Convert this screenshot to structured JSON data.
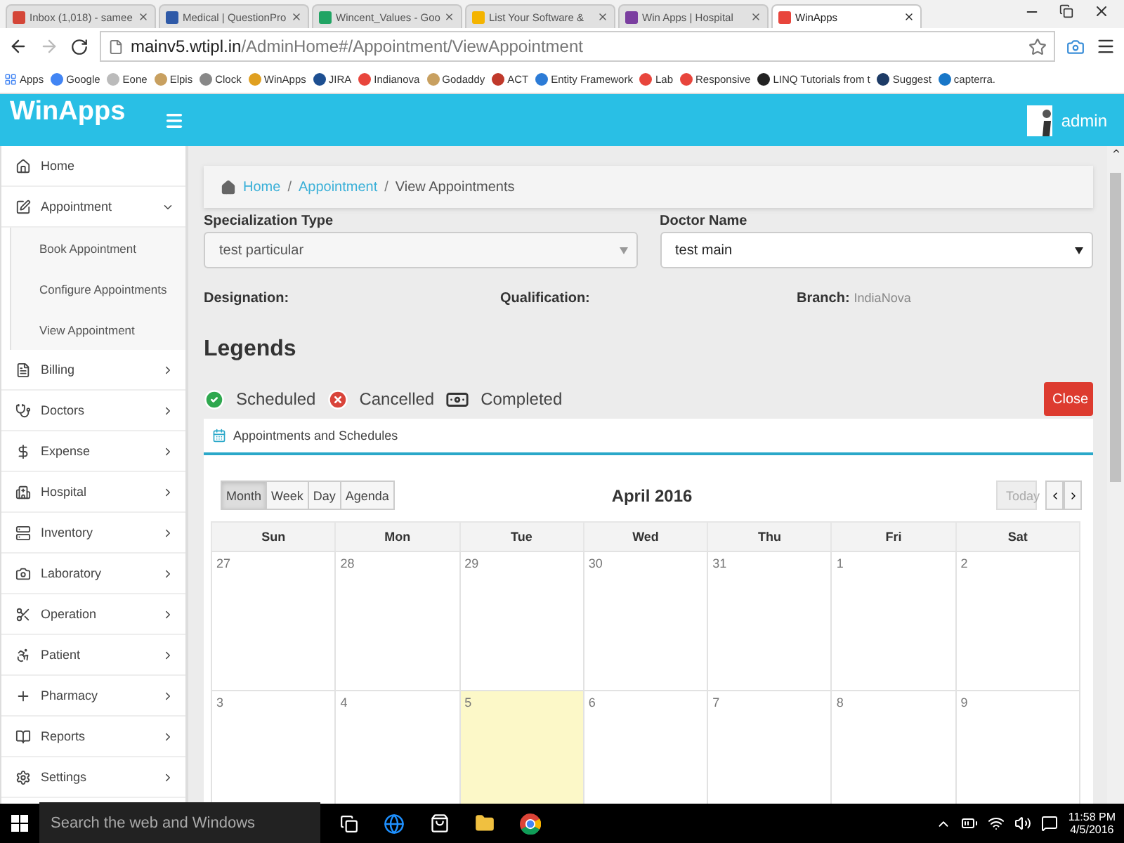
{
  "browser": {
    "tabs": [
      {
        "title": "Inbox (1,018) - samee",
        "selected": false
      },
      {
        "title": "Medical | QuestionPro",
        "selected": false
      },
      {
        "title": "Wincent_Values - Goo",
        "selected": false
      },
      {
        "title": "List Your Software &",
        "selected": false
      },
      {
        "title": "Win Apps | Hospital",
        "selected": false
      },
      {
        "title": "WinApps",
        "selected": true
      }
    ],
    "address": {
      "host": "mainv5.wtipl.in",
      "path": "/AdminHome#/Appointment/ViewAppointment"
    },
    "bookmarks": [
      "Apps",
      "Google",
      "Eone",
      "Elpis",
      "Clock",
      "WinApps",
      "JIRA",
      "Indianova",
      "Godaddy",
      "ACT",
      "Entity Framework",
      "Lab",
      "Responsive",
      "LINQ Tutorials from t",
      "Suggest",
      "capterra."
    ]
  },
  "header": {
    "logo": "WinApps",
    "user": "admin"
  },
  "sidebar": {
    "items": [
      {
        "label": "Home",
        "kind": "link"
      },
      {
        "label": "Appointment",
        "kind": "menu",
        "expanded": true,
        "children": [
          {
            "label": "Book Appointment"
          },
          {
            "label": "Configure Appointments"
          },
          {
            "label": "View Appointment"
          }
        ]
      },
      {
        "label": "Billing",
        "kind": "menu",
        "expanded": false
      },
      {
        "label": "Doctors",
        "kind": "menu",
        "expanded": false
      },
      {
        "label": "Expense",
        "kind": "menu",
        "expanded": false
      },
      {
        "label": "Hospital",
        "kind": "menu",
        "expanded": false
      },
      {
        "label": "Inventory",
        "kind": "menu",
        "expanded": false
      },
      {
        "label": "Laboratory",
        "kind": "menu",
        "expanded": false
      },
      {
        "label": "Operation",
        "kind": "menu",
        "expanded": false
      },
      {
        "label": "Patient",
        "kind": "menu",
        "expanded": false
      },
      {
        "label": "Pharmacy",
        "kind": "menu",
        "expanded": false
      },
      {
        "label": "Reports",
        "kind": "menu",
        "expanded": false
      },
      {
        "label": "Settings",
        "kind": "menu",
        "expanded": false
      }
    ]
  },
  "breadcrumb": {
    "items": [
      {
        "label": "Home",
        "link": true
      },
      {
        "label": "Appointment",
        "link": true
      },
      {
        "label": "View Appointments",
        "link": false
      }
    ],
    "separators": [
      "/",
      "/"
    ]
  },
  "form": {
    "selects": [
      {
        "label": "Specialization Type",
        "value": "test particular",
        "disabled": true
      },
      {
        "label": "Doctor Name",
        "value": "test main",
        "disabled": false
      }
    ],
    "info": [
      {
        "label": "Designation:"
      },
      {
        "label": "Qualification:"
      },
      {
        "label": "Branch:",
        "value": "IndiaNova"
      }
    ]
  },
  "legends": {
    "title": "Legends",
    "items": [
      {
        "label": "Scheduled",
        "kind": "scheduled"
      },
      {
        "label": "Cancelled",
        "kind": "cancelled"
      },
      {
        "label": "Completed",
        "kind": "completed"
      }
    ],
    "close_button": "Close"
  },
  "calendar": {
    "panel_title": "Appointments and Schedules",
    "views": [
      {
        "label": "Month",
        "selected": true
      },
      {
        "label": "Week",
        "selected": false
      },
      {
        "label": "Day",
        "selected": false
      },
      {
        "label": "Agenda",
        "selected": false
      }
    ],
    "title": "April 2016",
    "today_button": {
      "label": "Today",
      "disabled": true
    },
    "weekdays": [
      "Sun",
      "Mon",
      "Tue",
      "Wed",
      "Thu",
      "Fri",
      "Sat"
    ],
    "weeks": [
      [
        {
          "day": "27",
          "today": false
        },
        {
          "day": "28",
          "today": false
        },
        {
          "day": "29",
          "today": false
        },
        {
          "day": "30",
          "today": false
        },
        {
          "day": "31",
          "today": false
        },
        {
          "day": "1",
          "today": false
        },
        {
          "day": "2",
          "today": false
        }
      ],
      [
        {
          "day": "3",
          "today": false
        },
        {
          "day": "4",
          "today": false
        },
        {
          "day": "5",
          "today": true
        },
        {
          "day": "6",
          "today": false
        },
        {
          "day": "7",
          "today": false
        },
        {
          "day": "8",
          "today": false
        },
        {
          "day": "9",
          "today": false
        }
      ]
    ]
  },
  "taskbar": {
    "search": {
      "placeholder": "Search the web and Windows"
    },
    "time": "11:58 PM",
    "date": "4/5/2016"
  }
}
